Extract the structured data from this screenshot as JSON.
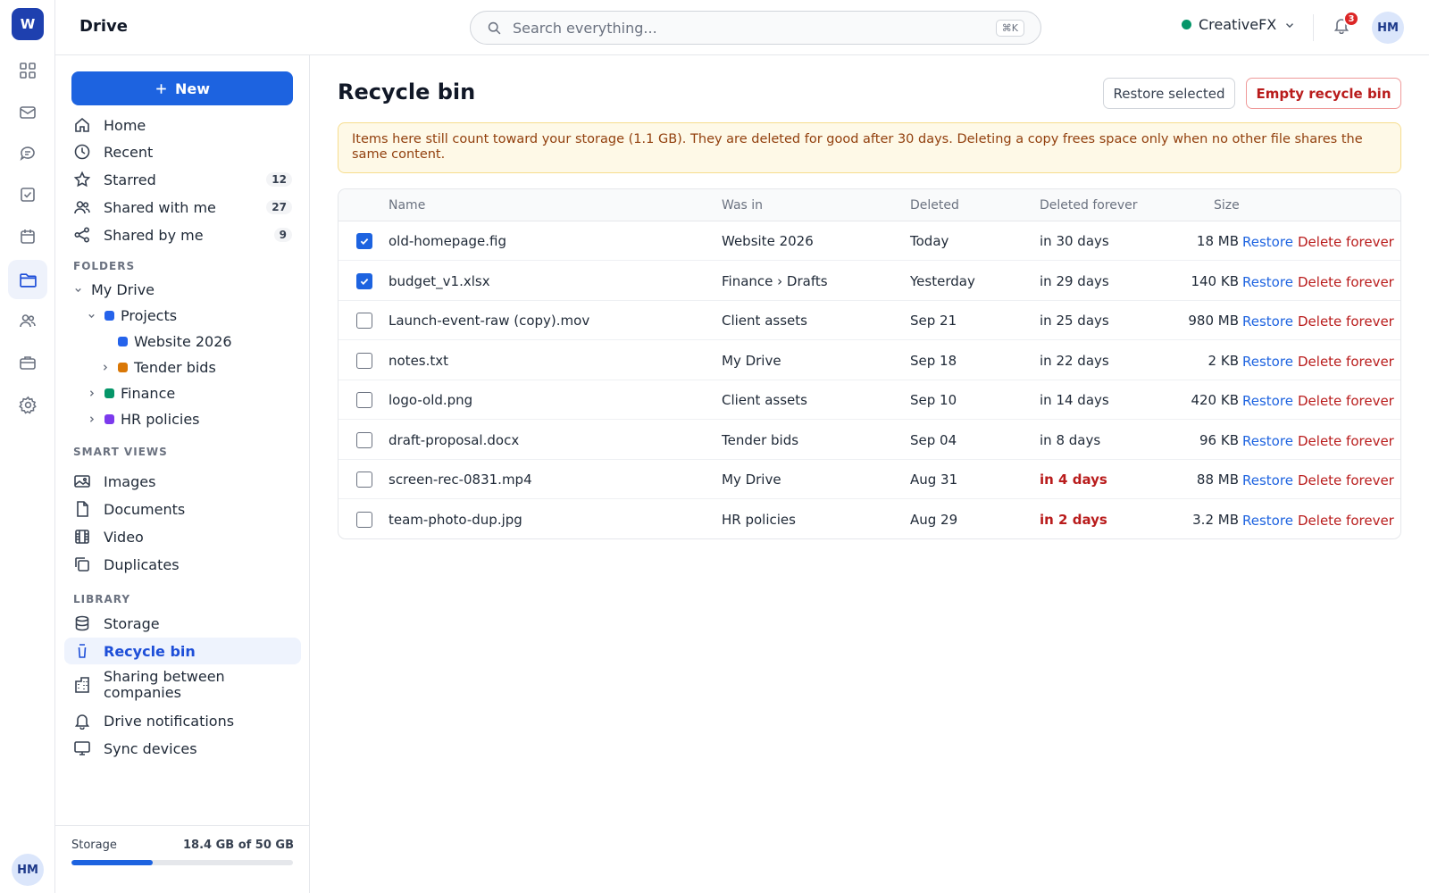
{
  "rail": {
    "logo": "W",
    "avatar": "HM"
  },
  "header": {
    "app_title": "Drive",
    "search_placeholder": "Search everything...",
    "search_shortcut": "⌘K",
    "workspace": "CreativeFX",
    "notification_count": "3",
    "avatar": "HM"
  },
  "sidebar": {
    "new_label": "New",
    "nav": [
      {
        "label": "Home",
        "icon": "home-icon"
      },
      {
        "label": "Recent",
        "icon": "clock-icon"
      },
      {
        "label": "Starred",
        "icon": "star-icon",
        "count": "12"
      },
      {
        "label": "Shared with me",
        "icon": "users-icon",
        "count": "27"
      },
      {
        "label": "Shared by me",
        "icon": "share-icon",
        "count": "9"
      }
    ],
    "folders_heading": "FOLDERS",
    "folders": [
      {
        "label": "My Drive"
      },
      {
        "label": "Projects",
        "color": "#2563eb"
      },
      {
        "label": "Website 2026",
        "color": "#2563eb"
      },
      {
        "label": "Tender bids",
        "color": "#d97706"
      },
      {
        "label": "Finance",
        "color": "#059669"
      },
      {
        "label": "HR policies",
        "color": "#7c3aed"
      }
    ],
    "smart_heading": "SMART VIEWS",
    "smart": [
      {
        "label": "Images",
        "icon": "image-icon"
      },
      {
        "label": "Documents",
        "icon": "document-icon"
      },
      {
        "label": "Video",
        "icon": "film-icon"
      },
      {
        "label": "Duplicates",
        "icon": "copy-icon"
      }
    ],
    "library_heading": "LIBRARY",
    "library": [
      {
        "label": "Storage",
        "icon": "database-icon"
      },
      {
        "label": "Recycle bin",
        "icon": "trash-icon"
      },
      {
        "label": "Sharing between companies",
        "icon": "building-icon"
      },
      {
        "label": "Drive notifications",
        "icon": "bell-icon"
      },
      {
        "label": "Sync devices",
        "icon": "monitor-icon"
      }
    ],
    "storage_label": "Storage",
    "storage_value": "18.4 GB of 50 GB",
    "storage_used_fraction": 0.368
  },
  "main": {
    "title": "Recycle bin",
    "restore_selected": "Restore selected",
    "empty_bin": "Empty recycle bin",
    "notice": "Items here still count toward your storage (1.1 GB). They are deleted for good after 30 days. Deleting a copy frees space only when no other file shares the same content.",
    "columns": {
      "name": "Name",
      "was_in": "Was in",
      "deleted": "Deleted",
      "deleted_forever": "Deleted forever",
      "size": "Size"
    },
    "restore_label": "Restore",
    "delete_label": "Delete forever",
    "rows": [
      {
        "name": "old-homepage.fig",
        "was_in": "Website 2026",
        "deleted": "Today",
        "forever": "in 30 days",
        "size": "18 MB",
        "checked": true,
        "urgent": false
      },
      {
        "name": "budget_v1.xlsx",
        "was_in": "Finance › Drafts",
        "deleted": "Yesterday",
        "forever": "in 29 days",
        "size": "140 KB",
        "checked": true,
        "urgent": false
      },
      {
        "name": "Launch-event-raw (copy).mov",
        "was_in": "Client assets",
        "deleted": "Sep 21",
        "forever": "in 25 days",
        "size": "980 MB",
        "checked": false,
        "urgent": false
      },
      {
        "name": "notes.txt",
        "was_in": "My Drive",
        "deleted": "Sep 18",
        "forever": "in 22 days",
        "size": "2 KB",
        "checked": false,
        "urgent": false
      },
      {
        "name": "logo-old.png",
        "was_in": "Client assets",
        "deleted": "Sep 10",
        "forever": "in 14 days",
        "size": "420 KB",
        "checked": false,
        "urgent": false
      },
      {
        "name": "draft-proposal.docx",
        "was_in": "Tender bids",
        "deleted": "Sep 04",
        "forever": "in 8 days",
        "size": "96 KB",
        "checked": false,
        "urgent": false
      },
      {
        "name": "screen-rec-0831.mp4",
        "was_in": "My Drive",
        "deleted": "Aug 31",
        "forever": "in 4 days",
        "size": "88 MB",
        "checked": false,
        "urgent": true
      },
      {
        "name": "team-photo-dup.jpg",
        "was_in": "HR policies",
        "deleted": "Aug 29",
        "forever": "in 2 days",
        "size": "3.2 MB",
        "checked": false,
        "urgent": true
      }
    ]
  }
}
